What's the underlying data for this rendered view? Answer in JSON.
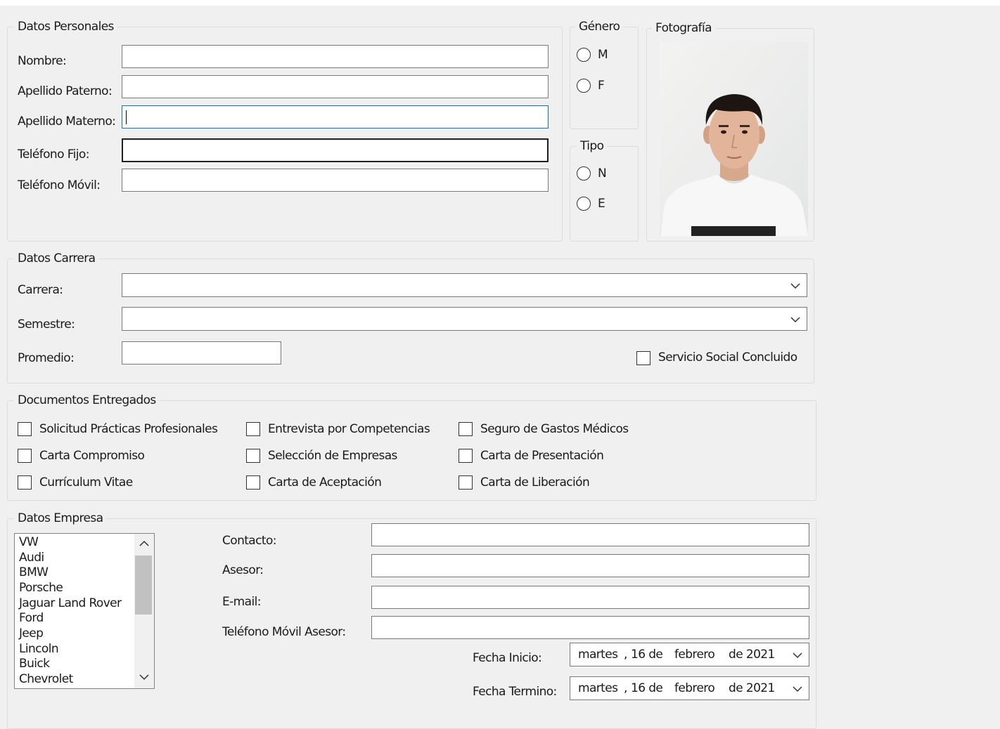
{
  "personal": {
    "group_title": "Datos Personales",
    "nombre_label": "Nombre:",
    "apellido_paterno_label": "Apellido Paterno:",
    "apellido_materno_label": "Apellido Materno:",
    "telefono_fijo_label": "Teléfono Fijo:",
    "telefono_movil_label": "Teléfono Móvil:",
    "nombre_value": "",
    "apellido_paterno_value": "",
    "apellido_materno_value": "",
    "telefono_fijo_value": "",
    "telefono_movil_value": ""
  },
  "genero": {
    "group_title": "Género",
    "options": [
      "M",
      "F"
    ],
    "selected": null
  },
  "tipo": {
    "group_title": "Tipo",
    "options": [
      "N",
      "E"
    ],
    "selected": null
  },
  "fotografia": {
    "group_title": "Fotografía"
  },
  "carrera": {
    "group_title": "Datos Carrera",
    "carrera_label": "Carrera:",
    "semestre_label": "Semestre:",
    "promedio_label": "Promedio:",
    "carrera_value": "",
    "semestre_value": "",
    "promedio_value": "",
    "servicio_social_label": "Servicio Social Concluido",
    "servicio_social_checked": false
  },
  "documentos": {
    "group_title": "Documentos Entregados",
    "items": [
      {
        "label": "Solicitud Prácticas Profesionales",
        "checked": false
      },
      {
        "label": "Carta Compromiso",
        "checked": false
      },
      {
        "label": "Currículum Vitae",
        "checked": false
      },
      {
        "label": "Entrevista por Competencias",
        "checked": false
      },
      {
        "label": "Selección de Empresas",
        "checked": false
      },
      {
        "label": "Carta de Aceptación",
        "checked": false
      },
      {
        "label": "Seguro de Gastos Médicos",
        "checked": false
      },
      {
        "label": "Carta de Presentación",
        "checked": false
      },
      {
        "label": "Carta de Liberación",
        "checked": false
      }
    ]
  },
  "empresa": {
    "group_title": "Datos Empresa",
    "companies": [
      "VW",
      "Audi",
      "BMW",
      "Porsche",
      "Jaguar Land Rover",
      "Ford",
      "Jeep",
      "Lincoln",
      "Buick",
      "Chevrolet"
    ],
    "contacto_label": "Contacto:",
    "asesor_label": "Asesor:",
    "email_label": "E-mail:",
    "telefono_asesor_label": "Teléfono Móvil Asesor:",
    "contacto_value": "",
    "asesor_value": "",
    "email_value": "",
    "telefono_asesor_value": "",
    "fecha_inicio_label": "Fecha Inicio:",
    "fecha_termino_label": "Fecha Termino:",
    "fecha_inicio": {
      "weekday": "martes",
      "comma": ",",
      "day": "16 de",
      "month": "febrero",
      "year": "de 2021"
    },
    "fecha_termino": {
      "weekday": "martes",
      "comma": ",",
      "day": "16 de",
      "month": "febrero",
      "year": "de 2021"
    }
  },
  "icons": {
    "scroll_up": "chevron-up-icon",
    "scroll_down": "chevron-down-icon",
    "dropdown": "chevron-down-icon"
  },
  "colors": {
    "window_bg": "#f0f0f0",
    "focus_border": "#0078d7",
    "field_border": "#7a7a7a"
  }
}
